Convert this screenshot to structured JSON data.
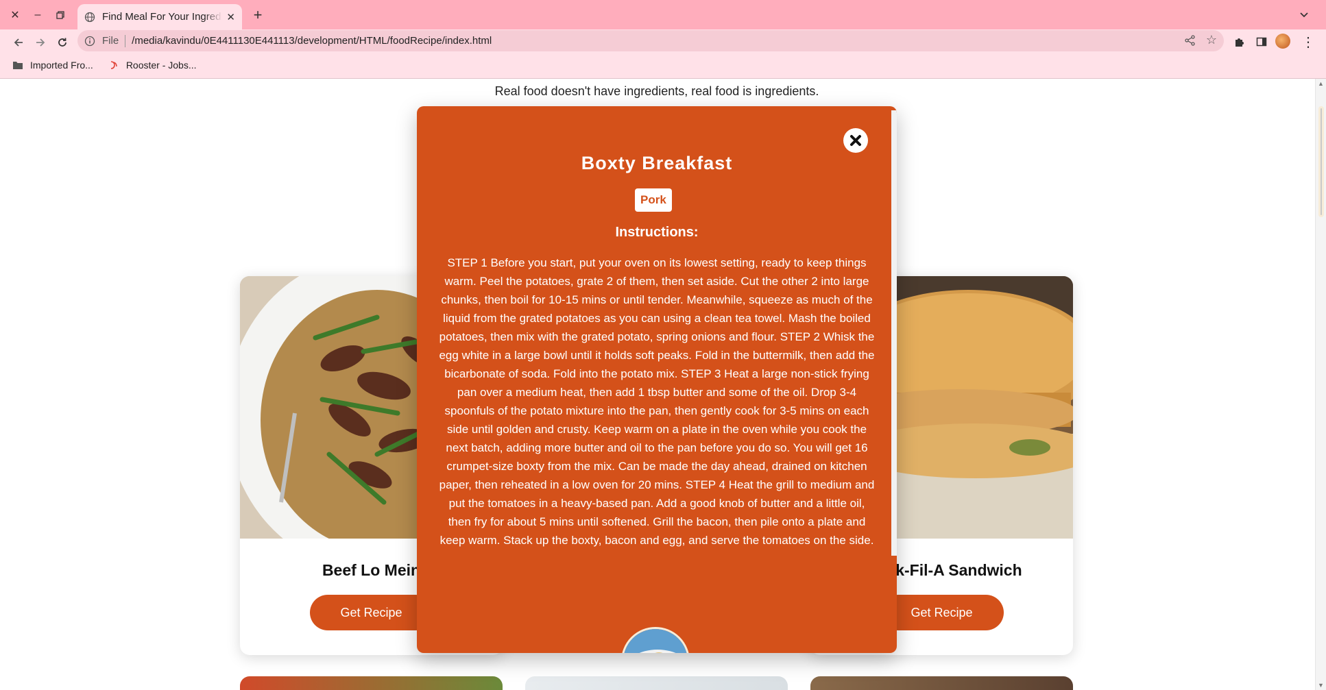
{
  "browser": {
    "tab_title": "Find Meal For Your Ingredients",
    "url_scheme": "File",
    "url": "/media/kavindu/0E4411130E441113/development/HTML/foodRecipe/index.html",
    "bookmarks": [
      {
        "label": "Imported Fro..."
      },
      {
        "label": "Rooster - Jobs..."
      }
    ]
  },
  "page": {
    "tagline": "Real food doesn't have ingredients, real food is ingredients.",
    "cards": [
      {
        "name": "Beef Lo Mein",
        "button": "Get Recipe"
      },
      {
        "name": "Chick-Fil-A Sandwich",
        "button": "Get Recipe"
      }
    ]
  },
  "modal": {
    "title": "Boxty Breakfast",
    "category": "Pork",
    "instructions_heading": "Instructions:",
    "instructions": "STEP 1 Before you start, put your oven on its lowest setting, ready to keep things warm. Peel the potatoes, grate 2 of them, then set aside. Cut the other 2 into large chunks, then boil for 10-15 mins or until tender. Meanwhile, squeeze as much of the liquid from the grated potatoes as you can using a clean tea towel. Mash the boiled potatoes, then mix with the grated potato, spring onions and flour. STEP 2 Whisk the egg white in a large bowl until it holds soft peaks. Fold in the buttermilk, then add the bicarbonate of soda. Fold into the potato mix. STEP 3 Heat a large non-stick frying pan over a medium heat, then add 1 tbsp butter and some of the oil. Drop 3-4 spoonfuls of the potato mixture into the pan, then gently cook for 3-5 mins on each side until golden and crusty. Keep warm on a plate in the oven while you cook the next batch, adding more butter and oil to the pan before you do so. You will get 16 crumpet-size boxty from the mix. Can be made the day ahead, drained on kitchen paper, then reheated in a low oven for 20 mins. STEP 4 Heat the grill to medium and put the tomatoes in a heavy-based pan. Add a good knob of butter and a little oil, then fry for about 5 mins until softened. Grill the bacon, then pile onto a plate and keep warm. Stack up the boxty, bacon and egg, and serve the tomatoes on the side."
  },
  "colors": {
    "accent": "#d4511a",
    "tabstrip": "#ffadbc",
    "toolbar": "#ffe1e8"
  }
}
